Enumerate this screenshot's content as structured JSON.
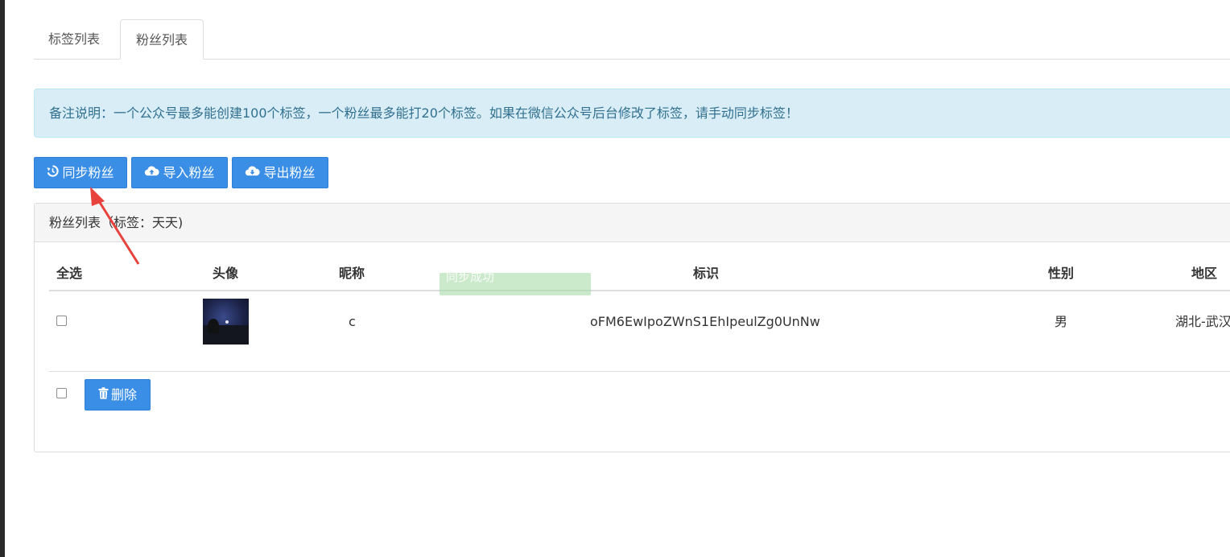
{
  "tabs": [
    {
      "label": "标签列表"
    },
    {
      "label": "粉丝列表"
    }
  ],
  "alert": {
    "text": "备注说明：一个公众号最多能创建100个标签，一个粉丝最多能打20个标签。如果在微信公众号后台修改了标签，请手动同步标签！"
  },
  "toolbar": {
    "sync_label": "同步粉丝",
    "import_label": "导入粉丝",
    "export_label": "导出粉丝"
  },
  "panel": {
    "title": "粉丝列表（标签：天天)"
  },
  "table": {
    "headers": {
      "select_all": "全选",
      "avatar": "头像",
      "nickname": "昵称",
      "openid": "标识",
      "gender": "性别",
      "region": "地区"
    },
    "rows": [
      {
        "nickname": "c",
        "openid": "oFM6EwIpoZWnS1EhIpeulZg0UnNw",
        "gender": "男",
        "region": "湖北-武汉"
      }
    ]
  },
  "toast": {
    "text": "同步成功"
  },
  "footer": {
    "delete_label": "删除"
  },
  "colors": {
    "primary": "#3a8ee6",
    "alert_bg": "#d9edf7",
    "alert_text": "#31708f",
    "annotation_arrow": "#e8423c"
  },
  "icons": {
    "sync": "history-icon",
    "import": "cloud-upload-icon",
    "export": "cloud-download-icon",
    "delete": "trash-icon"
  }
}
